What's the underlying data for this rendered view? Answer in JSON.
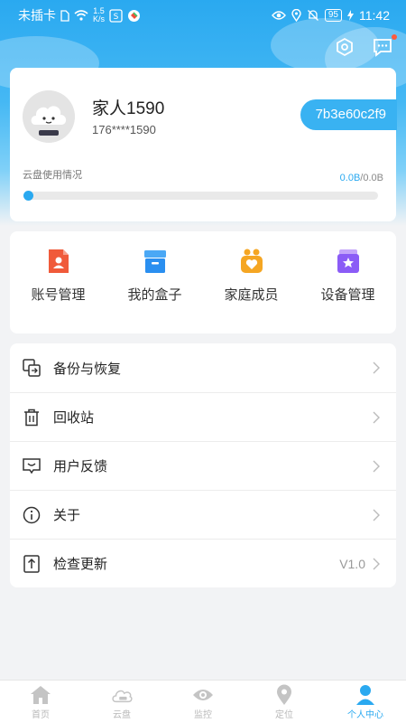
{
  "status_bar": {
    "carrier": "未插卡",
    "speed_value": "1.5",
    "speed_unit": "K/s",
    "battery": "95",
    "time": "11:42"
  },
  "top_actions": {
    "icons": [
      "settings-hex-icon",
      "message-icon"
    ],
    "message_badge_color": "#ff5a3c"
  },
  "profile": {
    "name": "家人1590",
    "phone": "176****1590",
    "device_id": "7b3e60c2f9",
    "cloud_label": "云盘使用情况",
    "cloud_used": "0.0B",
    "cloud_sep": "/",
    "cloud_total": "0.0B",
    "cloud_progress_percent": 0
  },
  "quick_actions": [
    {
      "label": "账号管理",
      "icon": "account-icon",
      "color": "#f05a3a"
    },
    {
      "label": "我的盒子",
      "icon": "box-icon",
      "color": "#2a8ff0"
    },
    {
      "label": "家庭成员",
      "icon": "family-icon",
      "color": "#f5a623"
    },
    {
      "label": "设备管理",
      "icon": "device-icon",
      "color": "#8b5cf6"
    }
  ],
  "menu": [
    {
      "label": "备份与恢复",
      "icon": "backup-icon"
    },
    {
      "label": "回收站",
      "icon": "trash-icon"
    },
    {
      "label": "用户反馈",
      "icon": "feedback-icon"
    },
    {
      "label": "关于",
      "icon": "info-icon"
    },
    {
      "label": "检查更新",
      "icon": "update-icon",
      "version": "V1.0"
    }
  ],
  "tabs": [
    {
      "label": "首页",
      "icon": "home-icon",
      "active": false
    },
    {
      "label": "云盘",
      "icon": "cloud-icon",
      "active": false
    },
    {
      "label": "监控",
      "icon": "eye-icon",
      "active": false
    },
    {
      "label": "定位",
      "icon": "location-icon",
      "active": false
    },
    {
      "label": "个人中心",
      "icon": "person-icon",
      "active": true
    }
  ],
  "colors": {
    "accent": "#2aa9f0",
    "inactive_tab": "#b8b8b8"
  }
}
